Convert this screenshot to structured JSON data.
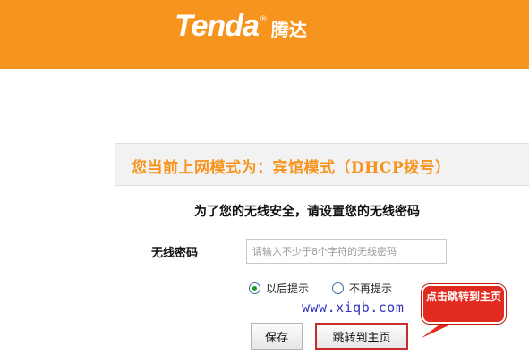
{
  "header": {
    "logo_en": "Tenda",
    "logo_reg": "®",
    "logo_cn": "腾达",
    "background_color": "#f7941d"
  },
  "mode": {
    "text": "您当前上网模式为：宾馆模式（DHCP拨号）",
    "color": "#f7941d"
  },
  "wireless": {
    "subtitle": "为了您的无线安全，请设置您的无线密码",
    "password_label": "无线密码",
    "password_value": "",
    "password_placeholder": "请输入不少于8个字符的无线密码"
  },
  "reminder": {
    "options": [
      {
        "label": "以后提示",
        "checked": true
      },
      {
        "label": "不再提示",
        "checked": false
      }
    ]
  },
  "watermark": "www.xiqb.com",
  "buttons": {
    "save_label": "保存",
    "home_label": "跳转到主页"
  },
  "annotation": {
    "text": "点击跳转到主页",
    "color": "#e22a1e"
  }
}
